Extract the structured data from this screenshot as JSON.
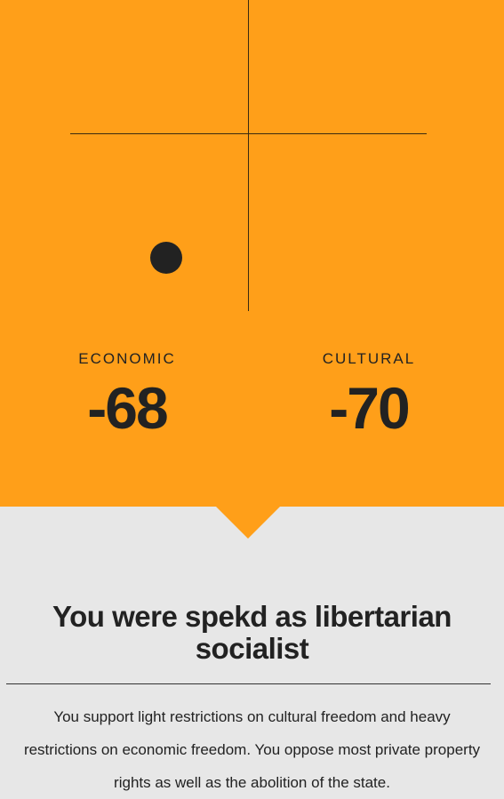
{
  "result": {
    "economic": {
      "label": "ECONOMIC",
      "value": "-68",
      "score": -68
    },
    "cultural": {
      "label": "CULTURAL",
      "value": "-70",
      "score": -70
    },
    "title": "You were spekd as libertarian socialist",
    "description": "You support light restrictions on cultural freedom and heavy restrictions on economic freedom. You oppose most private property rights as well as the abolition of the state."
  },
  "colors": {
    "accent": "#ff9f19",
    "background": "#e7e7e7",
    "text": "#222222"
  },
  "icons": {
    "marker": "position-dot-icon"
  }
}
